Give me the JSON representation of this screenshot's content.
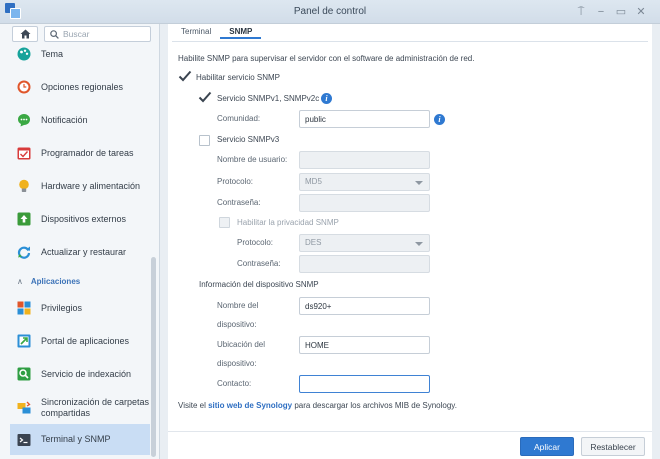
{
  "window": {
    "title": "Panel de control"
  },
  "sidebar": {
    "search_placeholder": "Buscar",
    "items": [
      {
        "label": "Tema",
        "icon": "theme-icon",
        "color": "#16a39b"
      },
      {
        "label": "Opciones regionales",
        "icon": "clock-icon",
        "color": "#e0562b"
      },
      {
        "label": "Notificación",
        "icon": "chat-icon",
        "color": "#3aa844"
      },
      {
        "label": "Programador de tareas",
        "icon": "calendar-icon",
        "color": "#d83b3b"
      },
      {
        "label": "Hardware y alimentación",
        "icon": "bulb-icon",
        "color": "#f0b21e"
      },
      {
        "label": "Dispositivos externos",
        "icon": "upload-icon",
        "color": "#3a9b3a"
      },
      {
        "label": "Actualizar y restaurar",
        "icon": "refresh-icon",
        "color": "#2b8fd6"
      }
    ],
    "section_label": "Aplicaciones",
    "app_items": [
      {
        "label": "Privilegios",
        "icon": "privileges-icon"
      },
      {
        "label": "Portal de aplicaciones",
        "icon": "portal-icon"
      },
      {
        "label": "Servicio de indexación",
        "icon": "index-icon"
      },
      {
        "label": "Sincronización de carpetas compartidas",
        "label_line1": "Sincronización de carpetas",
        "label_line2": "compartidas",
        "icon": "sync-icon"
      },
      {
        "label": "Terminal y SNMP",
        "icon": "terminal-icon",
        "selected": true
      }
    ]
  },
  "tabs": [
    {
      "label": "Terminal"
    },
    {
      "label": "SNMP",
      "active": true
    }
  ],
  "snmp": {
    "intro": "Habilite SNMP para supervisar el servidor con el software de administración de red.",
    "enable_label": "Habilitar servicio SNMP",
    "enable_checked": true,
    "v1v2c_label": "Servicio SNMPv1, SNMPv2c",
    "v1v2c_checked": true,
    "community_label": "Comunidad:",
    "community_value": "public",
    "v3_label": "Servicio SNMPv3",
    "v3_checked": false,
    "username_label": "Nombre de usuario:",
    "username_value": "",
    "protocol_label": "Protocolo:",
    "protocol_value": "MD5",
    "password_label": "Contraseña:",
    "password_value": "",
    "privacy_label": "Habilitar la privacidad SNMP",
    "privacy_checked": false,
    "priv_protocol_label": "Protocolo:",
    "priv_protocol_value": "DES",
    "priv_password_label": "Contraseña:",
    "priv_password_value": "",
    "device_info_heading": "Información del dispositivo SNMP",
    "device_name_label_1": "Nombre del",
    "device_name_label_2": "dispositivo:",
    "device_name_value": "ds920+",
    "device_location_label_1": "Ubicación del",
    "device_location_label_2": "dispositivo:",
    "device_location_value": "HOME",
    "contact_label": "Contacto:",
    "contact_value": "",
    "mib_prefix": "Visite el ",
    "mib_link": "sitio web de Synology",
    "mib_suffix": " para descargar los archivos MIB de Synology."
  },
  "footer": {
    "apply_label": "Aplicar",
    "reset_label": "Restablecer"
  },
  "colors": {
    "accent": "#2f79d1",
    "selected_bg": "#c9ddf4"
  }
}
